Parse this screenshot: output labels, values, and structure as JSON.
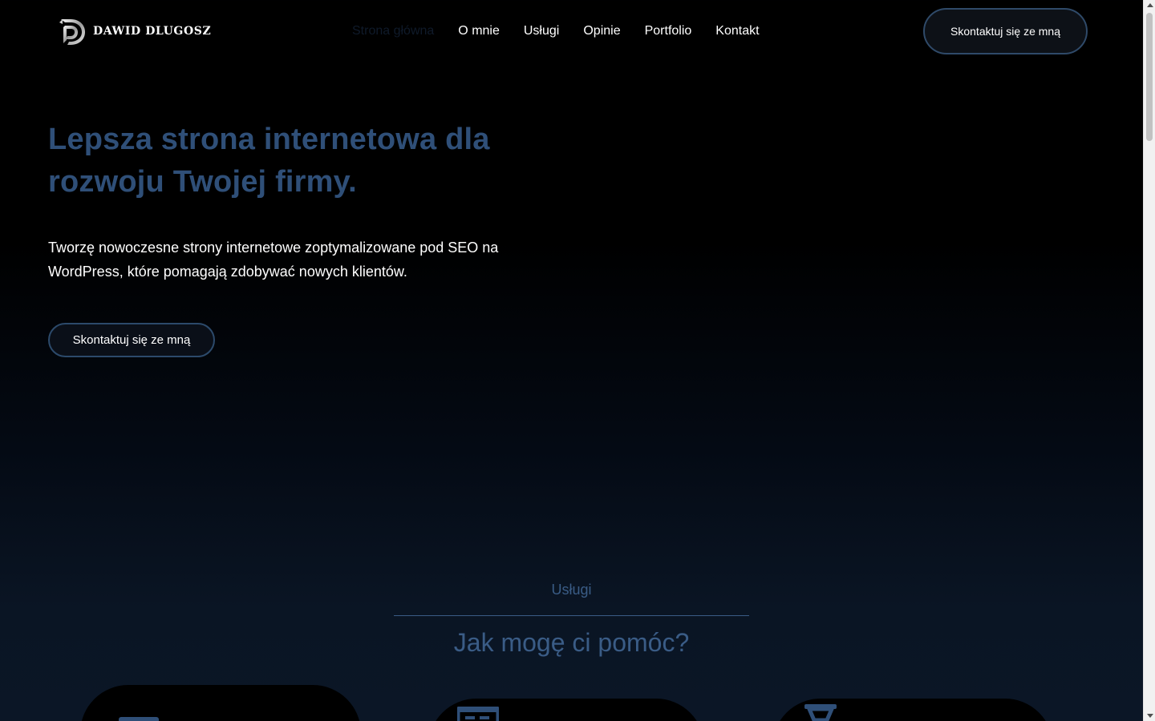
{
  "brand": {
    "name": "DAWID DLUGOSZ",
    "logo_icon": "dd-monogram-icon"
  },
  "nav": {
    "items": [
      {
        "label": "Strona główna",
        "active": true
      },
      {
        "label": "O mnie",
        "active": false
      },
      {
        "label": "Usługi",
        "active": false
      },
      {
        "label": "Opinie",
        "active": false
      },
      {
        "label": "Portfolio",
        "active": false
      },
      {
        "label": "Kontakt",
        "active": false
      }
    ],
    "cta_label": "Skontaktuj się ze mną"
  },
  "hero": {
    "title": "Lepsza strona internetowa dla rozwoju Twojej firmy.",
    "text": "Tworzę nowoczesne strony internetowe zoptymalizowane pod SEO na WordPress, które pomagają zdobywać nowych klientów.",
    "cta_label": "Skontaktuj się ze mną"
  },
  "services": {
    "eyebrow": "Usługi",
    "title": "Jak mogę ci pomóc?",
    "cards": [
      {
        "icon": "monitor-icon"
      },
      {
        "icon": "browser-window-icon"
      },
      {
        "icon": "hourglass-icon"
      }
    ]
  },
  "colors": {
    "accent": "#2f4f78",
    "accent_light": "#3a5c86",
    "background": "#000000",
    "text": "#ffffff"
  }
}
